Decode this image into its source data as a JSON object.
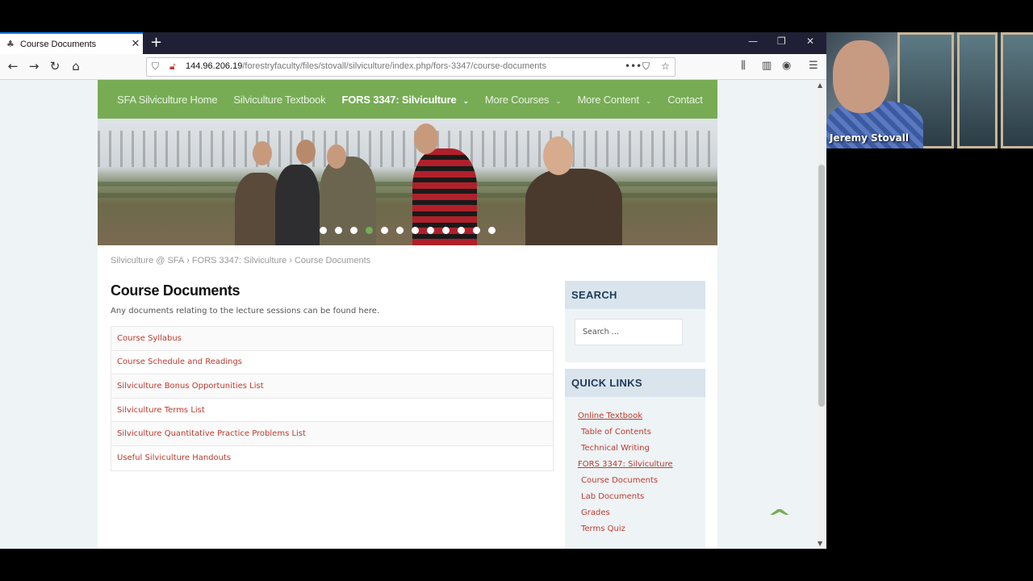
{
  "browser": {
    "tab_title": "Course Documents",
    "url_host": "144.96.206.19",
    "url_path": "/forestryfaculty/files/stovall/silviculture/index.php/fors-3347/course-documents"
  },
  "site": {
    "nav": [
      {
        "label": "SFA Silviculture Home"
      },
      {
        "label": "Silviculture Textbook"
      },
      {
        "label": "FORS 3347: Silviculture"
      },
      {
        "label": "More Courses"
      },
      {
        "label": "More Content"
      },
      {
        "label": "Contact"
      }
    ],
    "breadcrumb": [
      "Silviculture @ SFA",
      "FORS 3347: Silviculture",
      "Course Documents"
    ],
    "breadcrumb_sep": "›",
    "page_title": "Course Documents",
    "intro": "Any documents relating to the lecture sessions can be found here.",
    "documents": [
      "Course Syllabus",
      "Course Schedule and Readings",
      "Silviculture Bonus Opportunities List",
      "Silviculture Terms List",
      "Silviculture Quantitative Practice Problems List",
      "Useful Silviculture Handouts"
    ],
    "slider": {
      "count": 12,
      "active_index": 3
    },
    "sidebar": {
      "search_title": "SEARCH",
      "search_placeholder": "Search …",
      "quick_title": "QUICK LINKS",
      "quick_links": [
        {
          "label": "Online Textbook",
          "level": "top"
        },
        {
          "label": "Table of Contents",
          "level": "sub"
        },
        {
          "label": "Technical Writing",
          "level": "sub"
        },
        {
          "label": "FORS 3347: Silviculture",
          "level": "top"
        },
        {
          "label": "Course Documents",
          "level": "sub"
        },
        {
          "label": "Lab Documents",
          "level": "sub"
        },
        {
          "label": "Grades",
          "level": "sub"
        },
        {
          "label": "Terms Quiz",
          "level": "sub"
        }
      ]
    },
    "colors": {
      "nav_green": "#77ac55",
      "link_red": "#c0392b",
      "widget_title": "#1e3a5a"
    }
  },
  "webcam": {
    "name": "Jeremy Stovall"
  }
}
